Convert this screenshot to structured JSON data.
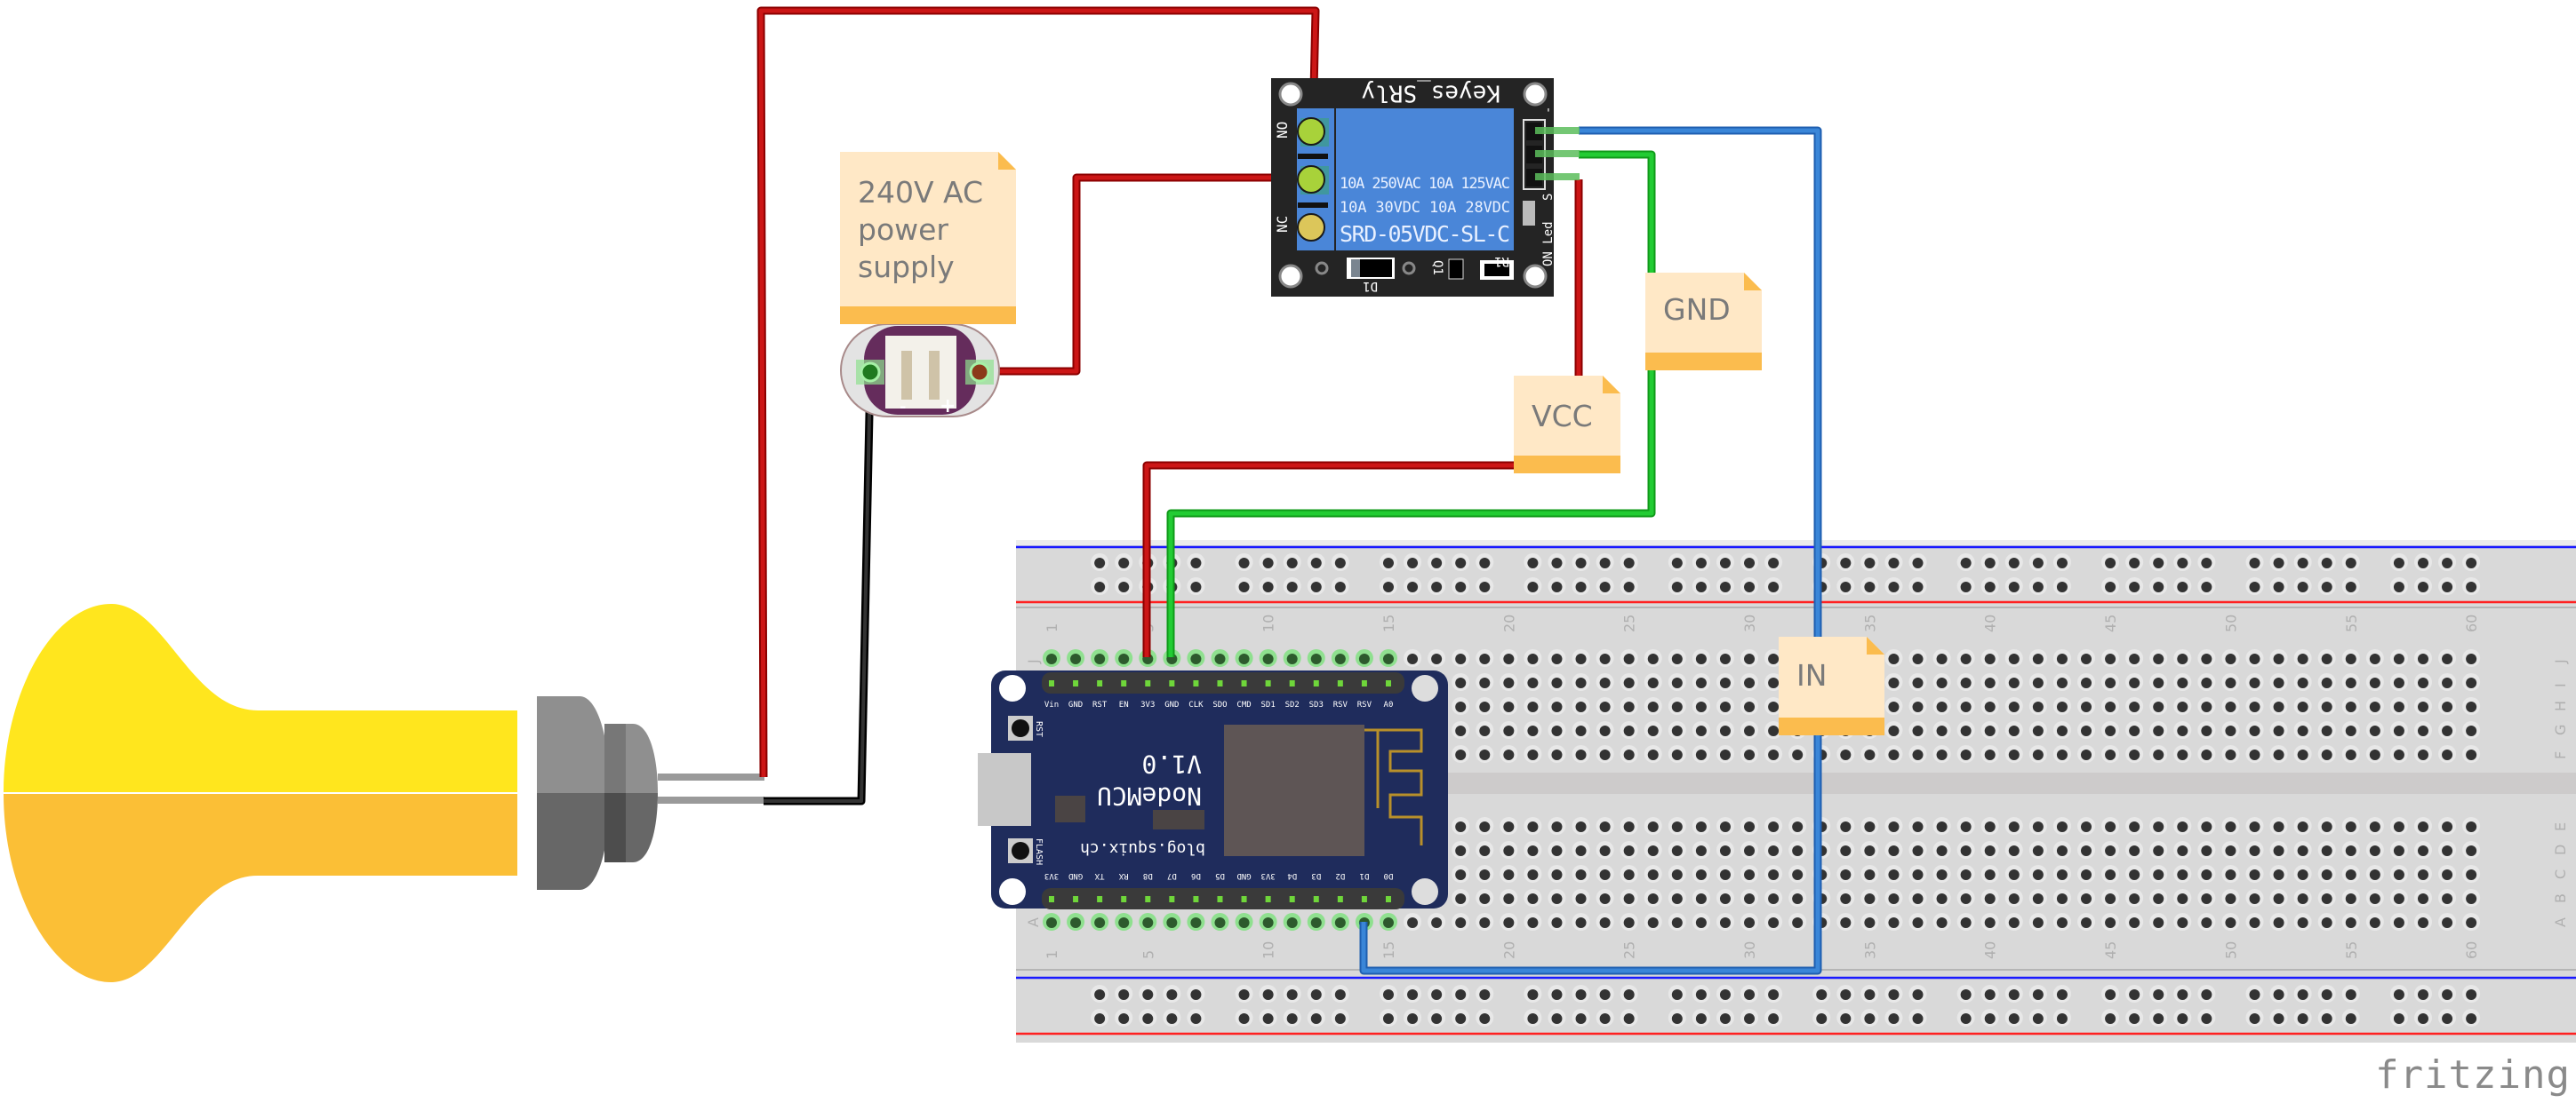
{
  "app": {
    "logo_text": "fritzing"
  },
  "notes": [
    {
      "id": "power-supply-note",
      "lines": [
        "240V AC",
        "power",
        "supply"
      ]
    },
    {
      "id": "gnd-note",
      "lines": [
        "GND"
      ]
    },
    {
      "id": "vcc-note",
      "lines": [
        "VCC"
      ]
    },
    {
      "id": "in-note",
      "lines": [
        "IN"
      ]
    }
  ],
  "relay": {
    "board_label": "Keyes_SRly",
    "rating_line1": "10A 250VAC  10A 125VAC",
    "rating_line2": "10A  30VDC  10A  28VDC",
    "model": "SRD-05VDC-SL-C",
    "terminal_labels": [
      "NO",
      "NC"
    ],
    "pin_labels": [
      "-",
      "S"
    ],
    "led_label": "ON_Led",
    "component_labels": [
      "D1",
      "Q1",
      "R1"
    ]
  },
  "nodemcu": {
    "title": "NodeMCU",
    "version": "V1.0",
    "url": "blog.squix.ch",
    "buttons": [
      "RST",
      "FLASH"
    ],
    "top_pins": [
      "Vin",
      "GND",
      "RST",
      "EN",
      "3V3",
      "GND",
      "CLK",
      "SDO",
      "CMD",
      "SD1",
      "SD2",
      "SD3",
      "RSV",
      "RSV",
      "A0"
    ],
    "bottom_pins": [
      "3V3",
      "GND",
      "TX",
      "RX",
      "D8",
      "D7",
      "D6",
      "D5",
      "GND",
      "3V3",
      "D4",
      "D3",
      "D2",
      "D1",
      "D0"
    ]
  },
  "power_supply": {
    "pin_minus": "-",
    "pin_plus": "+"
  },
  "breadboard": {
    "columns": 60,
    "column_number_labels": [
      "1",
      "5",
      "10",
      "15",
      "20",
      "25",
      "30",
      "35",
      "40",
      "45",
      "50",
      "55",
      "60"
    ],
    "top_rows": [
      "J",
      "I",
      "H",
      "G",
      "F"
    ],
    "bottom_rows": [
      "E",
      "D",
      "C",
      "B",
      "A"
    ]
  },
  "wires": [
    {
      "name": "lamp-to-relay-no",
      "color": "#cc1616"
    },
    {
      "name": "supply-plus-to-relay-com",
      "color": "#cc1616"
    },
    {
      "name": "supply-minus-to-lamp",
      "color": "#222222"
    },
    {
      "name": "relay-vcc-to-3v3",
      "color": "#cc1616"
    },
    {
      "name": "relay-gnd-to-gnd",
      "color": "#1fbf2a"
    },
    {
      "name": "relay-in-to-d1",
      "color": "#3a86d8"
    }
  ],
  "colors": {
    "bulb_top": "#ffe61e",
    "bulb_bottom": "#fbbf36",
    "note_body": "#ffe8c6",
    "note_bar": "#fbbc4e",
    "relay_blue": "#4a86d8",
    "nodemcu_pcb": "#1f2c5c",
    "breadboard": "#d9d9d9"
  }
}
